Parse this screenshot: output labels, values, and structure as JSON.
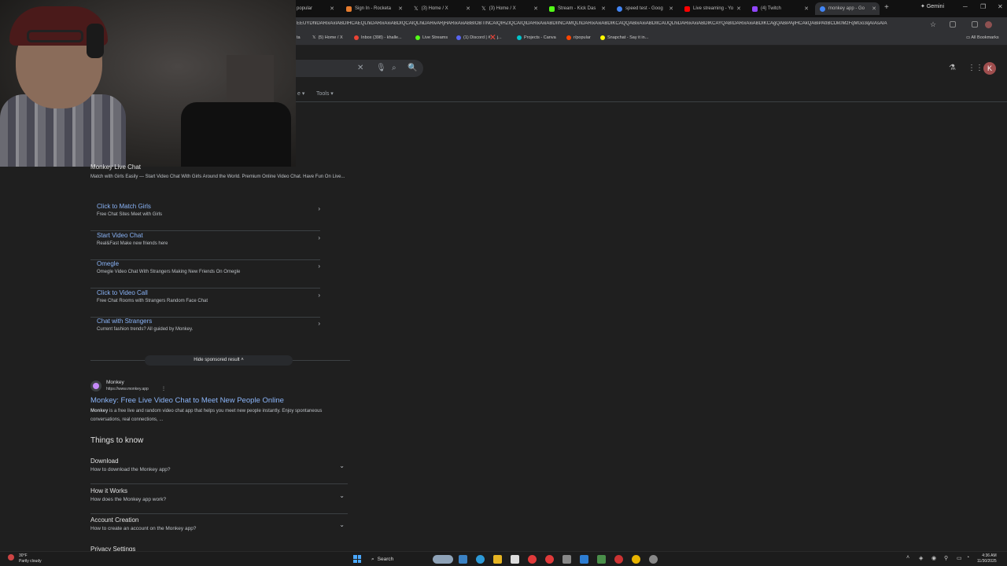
{
  "browser": {
    "tabs": [
      {
        "label": "popular",
        "color": "#6b6b6b"
      },
      {
        "label": "Sign In - Rocketa",
        "color": "#e67c2e"
      },
      {
        "label": "(3) Home / X",
        "color": "#ffffff"
      },
      {
        "label": "(3) Home / X",
        "color": "#ffffff"
      },
      {
        "label": "Stream - Kick Das",
        "color": "#53fc18"
      },
      {
        "label": "speed test - Goog",
        "color": "#4285f4"
      },
      {
        "label": "Live streaming - Yo",
        "color": "#ff0000"
      },
      {
        "label": "(4) Twitch",
        "color": "#9146ff"
      },
      {
        "label": "monkey app - Go",
        "color": "#4285f4"
      }
    ],
    "new_tab": "+",
    "gemini_label": "Gemini",
    "url": "EEUYDhlDARixAxIABDIHCAEQLhiDARixAxiABDIQCAIQLhiDARivARjHARixAxiABBIOBTINCAIQIHZIQCAIQIDARixAxiABDIINCAMQLhDARixAxiABDIKCAQQABixAxiABDIICAUQLhiDARixAxiABDIKCAYQABIDARixAxiABDIKCAgQABiPAjIHCAkQABiPAtIBCDk0MzFqMGo3qAIAsAIA",
    "bookmarks": [
      {
        "label": "ta",
        "color": "#888888"
      },
      {
        "label": "(5) Home / X",
        "color": "#ffffff"
      },
      {
        "label": "Inbox (398) - khalle...",
        "color": "#ea4335"
      },
      {
        "label": "Live Streams",
        "color": "#53fc18"
      },
      {
        "label": "(1) Discord | #❌ j...",
        "color": "#5865f2"
      },
      {
        "label": "Projects - Canva",
        "color": "#00c4cc"
      },
      {
        "label": "r/popular",
        "color": "#ff4500"
      },
      {
        "label": "Snapchat - Say it in...",
        "color": "#fffc00"
      }
    ],
    "all_bookmarks": "All Bookmarks"
  },
  "google": {
    "tools_label": "Tools",
    "ai_label": "e",
    "profile_initial": "K"
  },
  "ad": {
    "title_partial": "Monkey Live Chat",
    "description": "Match with Girls Easily — Start Video Chat With Girls Around the World. Premium Online Video Chat. Have Fun On Live...",
    "sitelinks": [
      {
        "title": "Click to Match Girls",
        "desc": "Free Chat Sites Meet with Girls"
      },
      {
        "title": "Start Video Chat",
        "desc": "Real&Fast Make new friends here"
      },
      {
        "title": "Omegle",
        "desc": "Omegle Video Chat With Strangers Making New Friends On Omegle"
      },
      {
        "title": "Click to Video Call",
        "desc": "Free Chat Rooms with Strangers Random Face Chat"
      },
      {
        "title": "Chat with Strangers",
        "desc": "Current fashion trends? All guided by Monkey."
      }
    ],
    "hide_label": "Hide sponsored result"
  },
  "organic": {
    "site_name": "Monkey",
    "site_url": "https://www.monkey.app",
    "title": "Monkey: Free Live Video Chat to Meet New People Online",
    "snippet_bold": "Monkey",
    "snippet": " is a free live and random video chat app that helps you meet new people instantly. Enjoy spontaneous conversations, real connections, ..."
  },
  "things_to_know": {
    "heading": "Things to know",
    "items": [
      {
        "title": "Download",
        "question": "How to download the Monkey app?"
      },
      {
        "title": "How it Works",
        "question": "How does the Monkey app work?"
      },
      {
        "title": "Account Creation",
        "question": "How to create an account on the Monkey app?"
      }
    ],
    "partial_item": "Privacy Settings"
  },
  "taskbar": {
    "weather_temp": "30°F",
    "weather_desc": "Partly cloudy",
    "search_label": "Search",
    "time": "4:36 AM",
    "date": "11/30/2025"
  }
}
